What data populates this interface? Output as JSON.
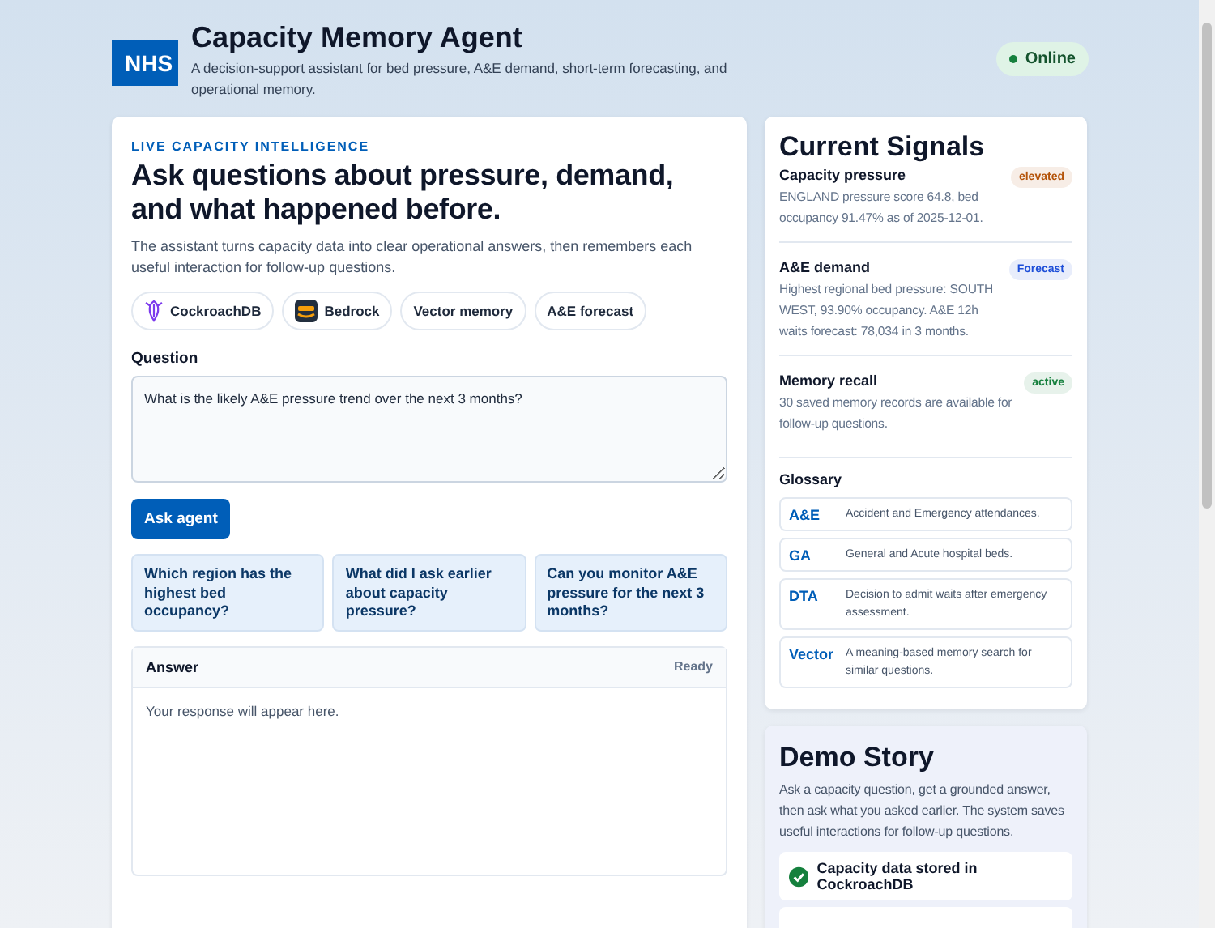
{
  "header": {
    "logo": "NHS",
    "title": "Capacity Memory Agent",
    "subtitle": "A decision-support assistant for bed pressure, A&E demand, short-term forecasting, and operational memory.",
    "status": {
      "label": "Online",
      "online": true
    }
  },
  "main": {
    "eyebrow": "LIVE CAPACITY INTELLIGENCE",
    "heading": "Ask questions about pressure, demand, and what happened before.",
    "intro": "The assistant turns capacity data into clear operational answers, then remembers each useful interaction for follow-up questions.",
    "chips": [
      {
        "label": "CockroachDB",
        "kind": "cockroach"
      },
      {
        "label": "Bedrock",
        "kind": "aws"
      },
      {
        "label": "Vector memory",
        "kind": "plain"
      },
      {
        "label": "A&E forecast",
        "kind": "plain"
      }
    ],
    "question_label": "Question",
    "question_value": "What is the likely A&E pressure trend over the next 3 months?",
    "ask_button": "Ask agent",
    "suggestions": [
      "Which region has the highest bed occupancy?",
      "What did I ask earlier about capacity pressure?",
      "Can you monitor A&E pressure for the next 3 months?"
    ],
    "answer": {
      "title": "Answer",
      "status": "Ready",
      "placeholder": "Your response will appear here."
    }
  },
  "signals": {
    "title": "Current Signals",
    "items": [
      {
        "name": "Capacity pressure",
        "badge": "elevated",
        "color": "#b45309",
        "text": "ENGLAND pressure score 64.8, bed occupancy 91.47% as of 2025-12-01."
      },
      {
        "name": "A&E demand",
        "badge": "Forecast",
        "color": "#1d4ed8",
        "text": "Highest regional bed pressure: SOUTH WEST, 93.90% occupancy. A&E 12h waits forecast: 78,034 in 3 months."
      },
      {
        "name": "Memory recall",
        "badge": "active",
        "color": "#15803d",
        "text": "30 saved memory records are available for follow-up questions."
      }
    ],
    "glossary_title": "Glossary",
    "glossary": [
      {
        "term": "A&E",
        "meaning": "Accident and Emergency attendances."
      },
      {
        "term": "GA",
        "meaning": "General and Acute hospital beds."
      },
      {
        "term": "DTA",
        "meaning": "Decision to admit waits after emergency assessment."
      },
      {
        "term": "Vector",
        "meaning": "A meaning-based memory search for similar questions."
      }
    ]
  },
  "demo": {
    "title": "Demo Story",
    "text": "Ask a capacity question, get a grounded answer, then ask what you asked earlier. The system saves useful interactions for follow-up questions.",
    "steps": [
      {
        "label": "Capacity data stored in CockroachDB",
        "done": true
      }
    ]
  }
}
